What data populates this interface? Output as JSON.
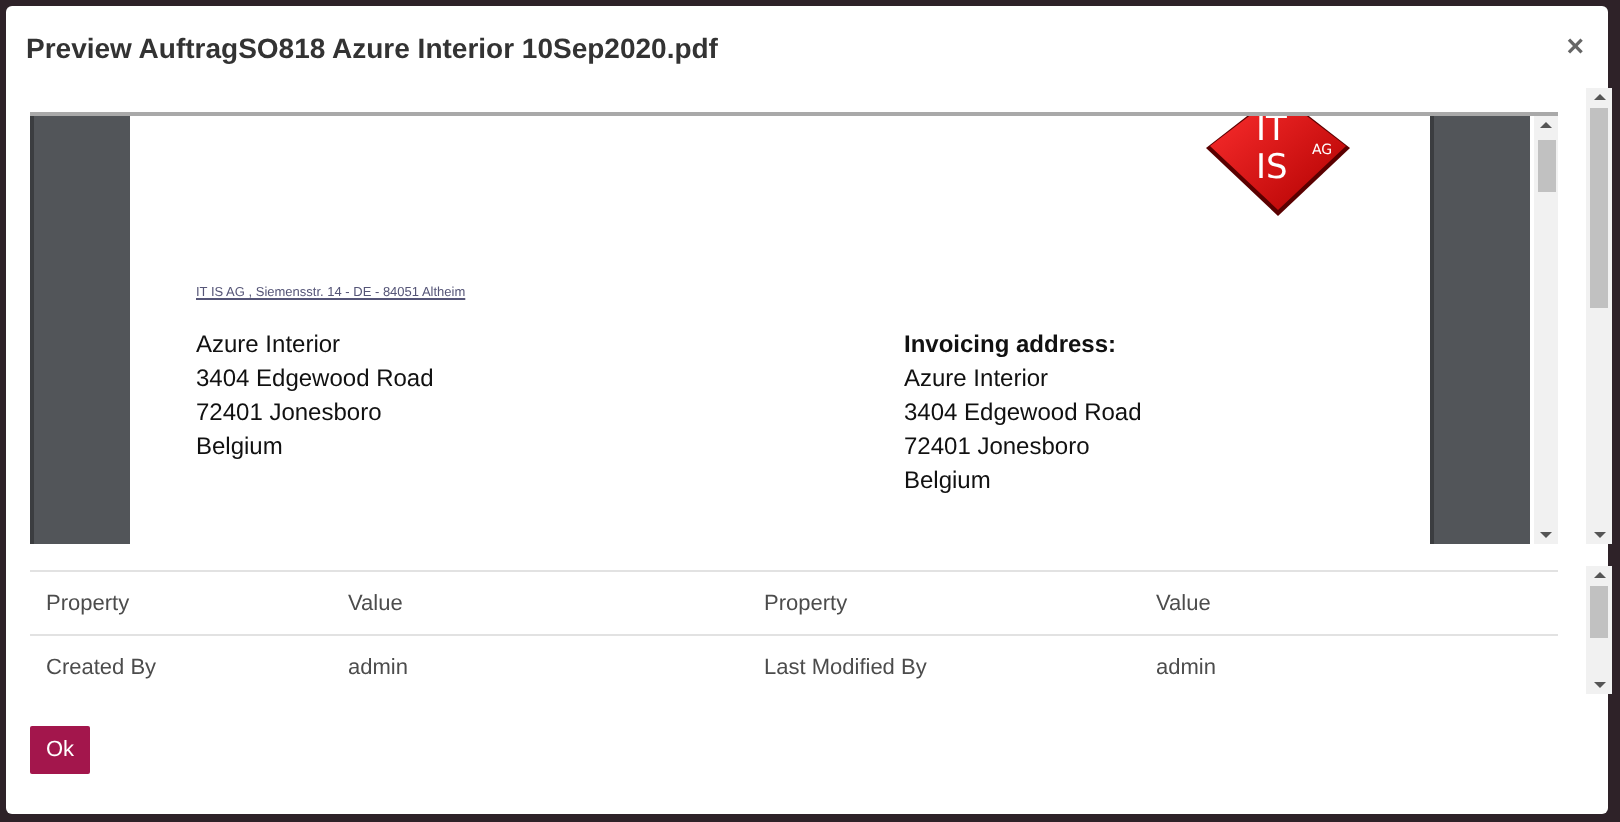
{
  "dialog": {
    "title": "Preview AuftragSO818 Azure Interior 10Sep2020.pdf",
    "close": "×"
  },
  "document": {
    "logo": {
      "line1": "IT",
      "line2": "IS",
      "suffix": "AG"
    },
    "sender_line": "IT IS AG , Siemensstr. 14 - DE - 84051 Altheim",
    "recipient": [
      "Azure Interior",
      "3404 Edgewood Road",
      "72401 Jonesboro",
      "Belgium"
    ],
    "invoicing": {
      "heading": "Invoicing address:",
      "lines": [
        "Azure Interior",
        "3404 Edgewood Road",
        "72401 Jonesboro",
        "Belgium"
      ]
    }
  },
  "properties": {
    "columns": [
      "Property",
      "Value",
      "Property",
      "Value"
    ],
    "rows": [
      [
        "Created By",
        "admin",
        "Last Modified By",
        "admin"
      ]
    ]
  },
  "buttons": [
    {
      "label": "Ok",
      "kind": "primary"
    }
  ]
}
